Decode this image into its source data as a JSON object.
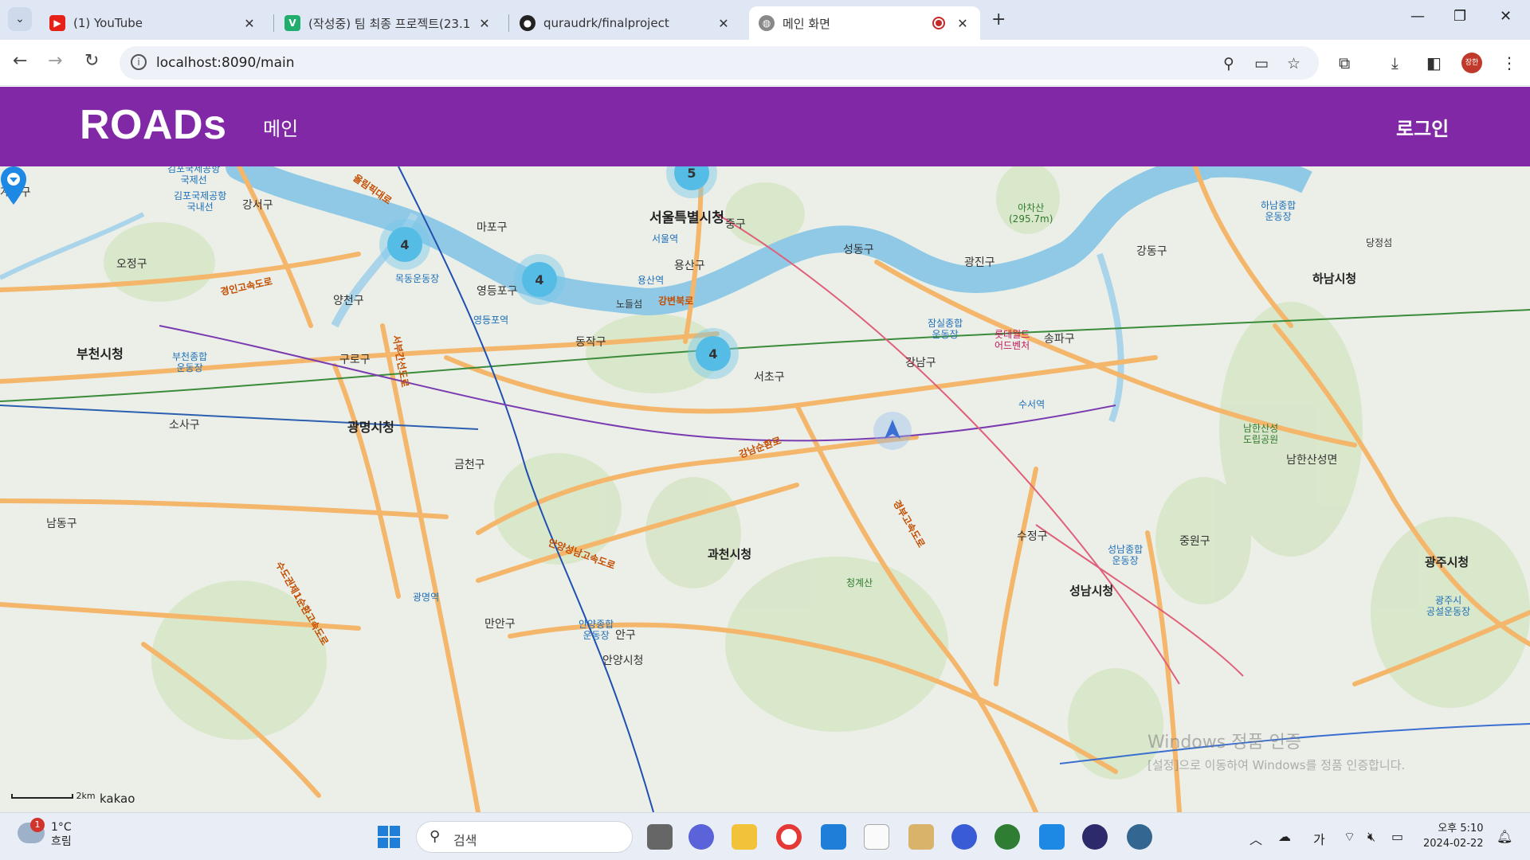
{
  "browser": {
    "tabs": [
      {
        "title": "(1) YouTube",
        "icon": "youtube-icon"
      },
      {
        "title": "(작성중) 팀 최종 프로젝트(23.1",
        "icon": "notion-v-icon"
      },
      {
        "title": "quraudrk/finalproject",
        "icon": "github-icon"
      },
      {
        "title": "메인 화면",
        "icon": "globe-icon",
        "active": true
      }
    ],
    "url": "localhost:8090/main",
    "profile_label": "장한"
  },
  "app": {
    "brand": "ROADs",
    "nav_main": "메인",
    "login": "로그인",
    "brand_color": "#8128a7"
  },
  "map": {
    "labels": {
      "gimpo_airport_intl": "김포국제공항\n국제선",
      "gimpo_airport_dom": "김포국제공항\n국내선",
      "gangseo": "강서구",
      "mapo": "마포구",
      "seoul_city_hall": "서울특별시청",
      "jung": "중구",
      "seoul_station": "서울역",
      "seongdong": "성동구",
      "gwangjin": "광진구",
      "gangdong": "강동구",
      "achasan": "아차산\n(295.7m)",
      "hanam_stadium": "하남종합\n운동장",
      "dangjeong": "당정섬",
      "hanam_city": "하남시청",
      "yangcheon": "양천구",
      "mokdong": "목동운동장",
      "yeongdeungpo": "영등포구",
      "yeongdeungpo_stn": "영등포역",
      "yongsan": "용산구",
      "yongsan_stn": "용산역",
      "nodeulseom": "노들섬",
      "jamsil": "잠실종합\n운동장",
      "lotteworld": "롯데월드\n어드벤처",
      "songpa": "송파구",
      "ojeong": "오정구",
      "bucheon_city": "부천시청",
      "bucheon_stadium": "부천종합\n운동장",
      "guro": "구로구",
      "dongjak": "동작구",
      "seocho": "서초구",
      "gangnam": "강남구",
      "suseo_stn": "수서역",
      "sosa": "소사구",
      "gwangmyeong_city": "광명시청",
      "geumcheon": "금천구",
      "namhansanseong": "남한산성\n도립공원",
      "namhansanseong_myeon": "남한산성면",
      "namdong": "남동구",
      "gwacheon_city": "과천시청",
      "sujeong": "수정구",
      "jungwon": "중원구",
      "gwangju_city": "광주시청",
      "cheonggyesan": "청계산",
      "seongnam_city": "성남시청",
      "seongnam_stadium": "성남종합\n운동장",
      "gwangmyeong_stn": "광명역",
      "manan": "만안구",
      "anyang_stadium": "안양종합\n운동장",
      "anyang_city": "안양시청",
      "gwangju_stadium": "광주시\n공설운동장",
      "dongan": "안구",
      "gyeyang": "계양구",
      "road_olympic_n": "올림픽대로",
      "road_gangbyeon": "강변북로",
      "road_gyeongin": "경인고속도로",
      "road_seobu": "서부간선도로",
      "road_gangnam_sunhwan": "강남순환로",
      "road_anyang_seongnam": "안양성남고속도로",
      "road_gyeongbu": "경부고속도로",
      "road_sudo": "수도권제1순환고속도로"
    },
    "clusters": [
      "5",
      "4",
      "4",
      "4"
    ],
    "scale_text": "2km",
    "attribution": "kakao"
  },
  "watermark": {
    "line1": "Windows 정품 인증",
    "line2": "[설정]으로 이동하여 Windows를 정품 인증합니다."
  },
  "taskbar": {
    "weather_badge": "1",
    "temp": "1°C",
    "condition": "흐림",
    "search_placeholder": "검색",
    "ime": "가",
    "time": "오후 5:10",
    "date": "2024-02-22"
  }
}
